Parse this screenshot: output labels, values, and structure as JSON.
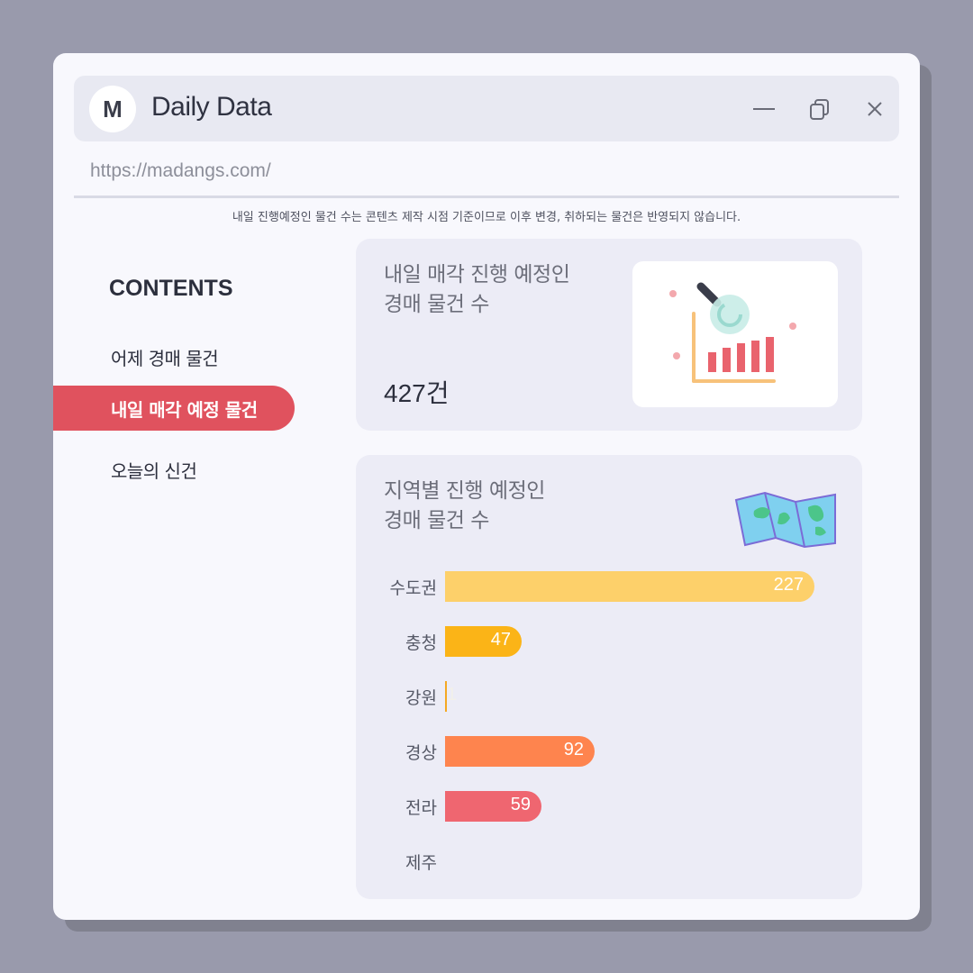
{
  "app": {
    "logo_letter": "M",
    "title": "Daily Data",
    "url": "https://madangs.com/"
  },
  "notice": "내일 진행예정인 물건 수는 콘텐츠 제작 시점 기준이므로 이후 변경, 취하되는 물건은 반영되지 않습니다.",
  "sidebar": {
    "heading": "CONTENTS",
    "items": [
      {
        "label": "어제 경매 물건",
        "active": false
      },
      {
        "label": "내일 매각 예정 물건",
        "active": true
      },
      {
        "label": "오늘의 신건",
        "active": false
      }
    ]
  },
  "summary_card": {
    "title_line1": "내일 매각 진행 예정인",
    "title_line2": "경매 물건 수",
    "count": "427건",
    "icon": "chart-magnifier-illustration"
  },
  "region_card": {
    "title_line1": "지역별 진행 예정인",
    "title_line2": "경매 물건 수",
    "icon": "map-icon"
  },
  "colors": {
    "accent": "#e0525e",
    "background": "#999aac",
    "window": "#f8f8fd",
    "card": "#ececf6"
  },
  "chart_data": {
    "type": "bar",
    "orientation": "horizontal",
    "categories": [
      "수도권",
      "충청",
      "강원",
      "경상",
      "전라",
      "제주"
    ],
    "values": [
      227,
      47,
      1,
      92,
      59,
      0
    ],
    "labels": [
      "227",
      "47",
      "1",
      "92",
      "59",
      ""
    ],
    "colors": [
      "#fdd06a",
      "#fbb417",
      "#f4a823",
      "#fe844e",
      "#ef6670",
      "#ef6670"
    ],
    "xlim": [
      0,
      227
    ],
    "grid": false
  }
}
